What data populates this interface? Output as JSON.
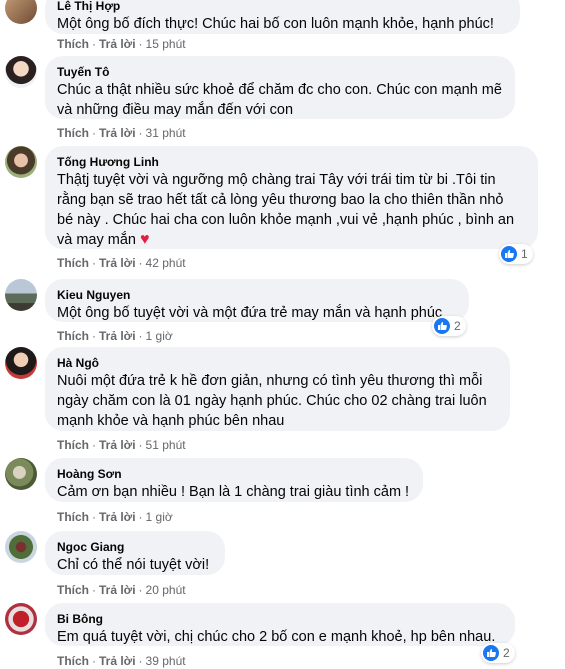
{
  "actions": {
    "like": "Thích",
    "reply": "Trả lời",
    "sep": "·"
  },
  "colors": {
    "bubble": "#f0f2f5",
    "like_blue": "#1877f2",
    "heart_red": "#e41e3f",
    "meta": "#65676b"
  },
  "comments": [
    {
      "name": "Lê Thị Hợp",
      "text": "Một ông bố đích thực! Chúc hai bố con luôn mạnh khỏe, hạnh phúc!",
      "time": "15 phút"
    },
    {
      "name": "Tuyến Tô",
      "text": "Chúc a thật nhiều sức khoẻ để chăm đc cho con. Chúc con mạnh mẽ\nvà những điều may mắn đến với con",
      "time": "31 phút"
    },
    {
      "name": "Tống Hương Linh",
      "text": "Thậtj tuyệt vời và ngưỡng mộ chàng trai Tây với trái tim từ bi .Tôi tin\nrằng bạn sẽ trao hết tất cả lòng yêu thương bao la cho thiên thần nhỏ\nbé này . Chúc hai cha con luôn khỏe mạnh ,vui vẻ ,hạnh phúc , bình an\nvà may mắn",
      "time": "42 phút",
      "reactions": "1",
      "heart_icon": "heart-icon"
    },
    {
      "name": "Kieu Nguyen",
      "text": "Một ông bố tuyệt vời và một đứa trẻ may mắn và hạnh phúc",
      "time": "1 giờ",
      "reactions": "2"
    },
    {
      "name": "Hà Ngô",
      "text": "Nuôi một đứa trẻ k hề đơn giản, nhưng có tình yêu thương thì mỗi\nngày chăm con là 01 ngày hạnh phúc. Chúc cho 02 chàng trai luôn\nmạnh khỏe và hạnh phúc bên nhau",
      "time": "51 phút"
    },
    {
      "name": "Hoàng Sơn",
      "text": "Cảm ơn bạn nhiều ! Bạn là 1 chàng trai giàu tình cảm !",
      "time": "1 giờ"
    },
    {
      "name": "Ngoc Giang",
      "text": "Chỉ có thể nói tuyệt vời!",
      "time": "20 phút"
    },
    {
      "name": "Bi Bông",
      "text": "Em quá tuyệt vời, chị chúc cho 2 bố con e mạnh khoẻ, hp bên nhau.",
      "time": "39 phút",
      "reactions": "2"
    }
  ]
}
